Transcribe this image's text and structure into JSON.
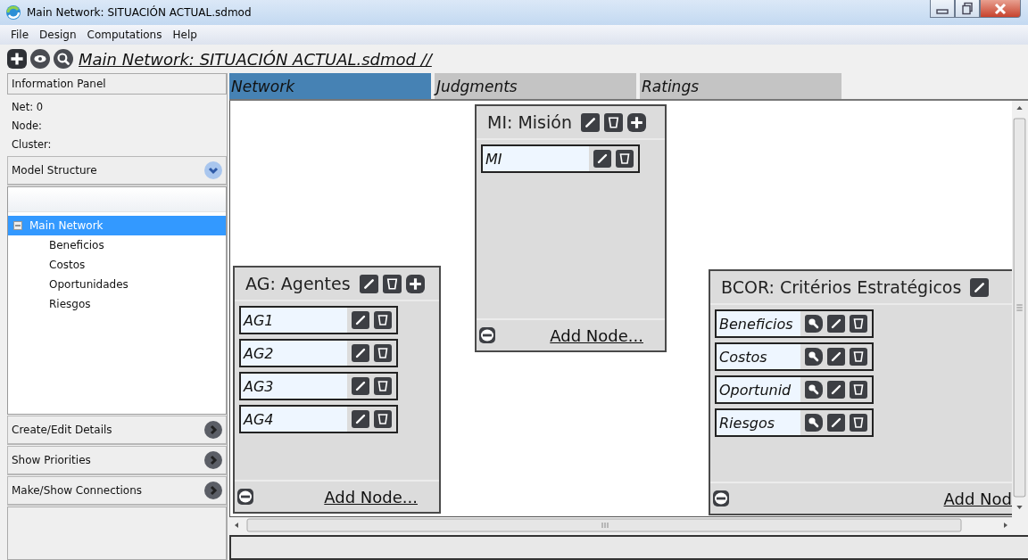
{
  "window": {
    "title": "Main Network: SITUACIÓN ACTUAL.sdmod"
  },
  "menu": [
    {
      "label": "File"
    },
    {
      "label": "Design"
    },
    {
      "label": "Computations"
    },
    {
      "label": "Help"
    }
  ],
  "toolbar": {
    "buttons": [
      {
        "kind": "add"
      },
      {
        "kind": "view"
      },
      {
        "kind": "zoom"
      }
    ],
    "path": "Main Network: SITUACIÓN ACTUAL.sdmod //"
  },
  "sidebar": {
    "info_panel": {
      "title": "Information Panel",
      "lines": [
        "Net: 0",
        "Node:",
        "Cluster:"
      ]
    },
    "model_structure": {
      "title": "Model Structure",
      "expanded": true,
      "tree": [
        {
          "label": "Main Network",
          "selected": true,
          "expanded": true,
          "children": [
            {
              "label": "Beneficios",
              "selected": false
            },
            {
              "label": "Costos",
              "selected": false
            },
            {
              "label": "Oportunidades",
              "selected": false
            },
            {
              "label": "Riesgos",
              "selected": false
            }
          ]
        }
      ]
    },
    "sections": [
      {
        "title": "Create/Edit Details",
        "expanded": false
      },
      {
        "title": "Show Priorities",
        "expanded": false
      },
      {
        "title": "Make/Show Connections",
        "expanded": false
      }
    ]
  },
  "tabs": [
    {
      "label": "Network",
      "selected": true
    },
    {
      "label": "Judgments",
      "selected": false
    },
    {
      "label": "Ratings",
      "selected": false
    }
  ],
  "clusters": [
    {
      "title": "MI: Misión",
      "header_buttons": [
        {
          "kind": "edit"
        },
        {
          "kind": "delete"
        },
        {
          "kind": "add"
        }
      ],
      "nodes": [
        {
          "label": "MI",
          "buttons": [
            {
              "kind": "edit"
            },
            {
              "kind": "delete"
            }
          ]
        }
      ],
      "add_node": "Add Node..."
    },
    {
      "title": "AG: Agentes",
      "header_buttons": [
        {
          "kind": "edit"
        },
        {
          "kind": "delete"
        },
        {
          "kind": "add"
        }
      ],
      "nodes": [
        {
          "label": "AG1",
          "buttons": [
            {
              "kind": "edit"
            },
            {
              "kind": "delete"
            }
          ]
        },
        {
          "label": "AG2",
          "buttons": [
            {
              "kind": "edit"
            },
            {
              "kind": "delete"
            }
          ]
        },
        {
          "label": "AG3",
          "buttons": [
            {
              "kind": "edit"
            },
            {
              "kind": "delete"
            }
          ]
        },
        {
          "label": "AG4",
          "buttons": [
            {
              "kind": "edit"
            },
            {
              "kind": "delete"
            }
          ]
        }
      ],
      "add_node": "Add Node..."
    },
    {
      "title": "BCOR: Critérios Estratégicos",
      "header_buttons": [
        {
          "kind": "edit"
        }
      ],
      "nodes": [
        {
          "label": "Beneficios",
          "buttons": [
            {
              "kind": "search"
            },
            {
              "kind": "edit"
            },
            {
              "kind": "delete"
            }
          ]
        },
        {
          "label": "Costos",
          "buttons": [
            {
              "kind": "search"
            },
            {
              "kind": "edit"
            },
            {
              "kind": "delete"
            }
          ]
        },
        {
          "label": "Oportunid",
          "buttons": [
            {
              "kind": "search"
            },
            {
              "kind": "edit"
            },
            {
              "kind": "delete"
            }
          ]
        },
        {
          "label": "Riesgos",
          "buttons": [
            {
              "kind": "search"
            },
            {
              "kind": "edit"
            },
            {
              "kind": "delete"
            }
          ]
        }
      ],
      "add_node": "Add Nod"
    }
  ]
}
